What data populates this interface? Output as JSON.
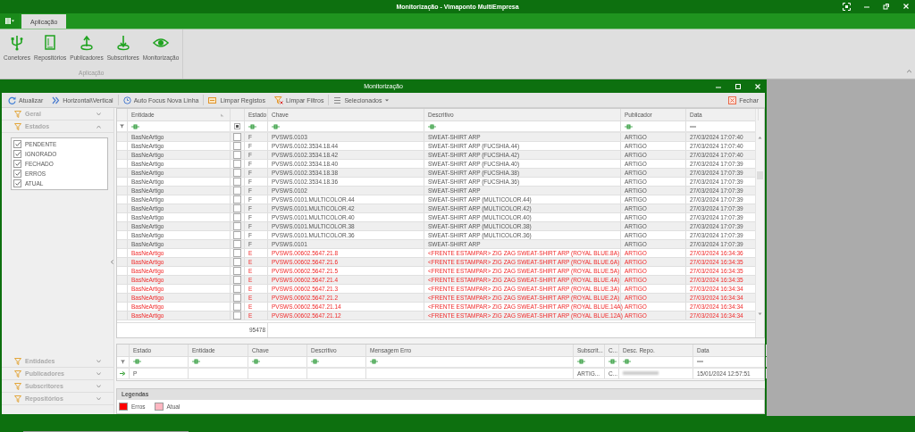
{
  "window": {
    "title": "Monitorização - Vimaponto MultiEmpresa"
  },
  "ribbon": {
    "tabs": [
      {
        "label": "Aplicação",
        "selected": true
      }
    ],
    "groups": [
      {
        "label": "Aplicação",
        "buttons": [
          {
            "label": "Conetores",
            "kind": "usb"
          },
          {
            "label": "Repositórios",
            "kind": "book"
          },
          {
            "label": "Publicadores",
            "kind": "upload"
          },
          {
            "label": "Subscritores",
            "kind": "download"
          },
          {
            "label": "Monitorização",
            "kind": "eye"
          }
        ]
      }
    ]
  },
  "child_window": {
    "title": "Monitorização"
  },
  "toolbar": {
    "buttons": [
      {
        "label": "Atualizar",
        "kind": "refresh"
      },
      {
        "label": "Horizontal\\Vertical",
        "kind": "chevrons"
      },
      {
        "label": "Auto Focus Nova Linha",
        "kind": "focus"
      },
      {
        "label": "Limpar Registos",
        "kind": "eraser"
      },
      {
        "label": "Limpar Filtros",
        "kind": "filterclear"
      },
      {
        "label": "Selecionados",
        "kind": "dropdown"
      }
    ],
    "close": {
      "label": "Fechar"
    }
  },
  "side_panel": {
    "top_sections": [
      {
        "label": "Geral",
        "expanded": false
      },
      {
        "label": "Estados",
        "expanded": true,
        "items": [
          {
            "label": "PENDENTE",
            "checked": true
          },
          {
            "label": "IGNORADO",
            "checked": true
          },
          {
            "label": "FECHADO",
            "checked": true
          },
          {
            "label": "ERROS",
            "checked": true
          },
          {
            "label": "ATUAL",
            "checked": true
          }
        ]
      }
    ],
    "bottom_sections": [
      {
        "label": "Entidades",
        "expanded": false
      },
      {
        "label": "Publicadores",
        "expanded": false
      },
      {
        "label": "Subscritores",
        "expanded": false
      },
      {
        "label": "Repositórios",
        "expanded": false
      }
    ]
  },
  "grid": {
    "columns": [
      {
        "label": "Entidade"
      },
      {
        "label": "Estado"
      },
      {
        "label": "Chave"
      },
      {
        "label": "Descritivo"
      },
      {
        "label": "Publicador"
      },
      {
        "label": "Data"
      }
    ],
    "rows": [
      {
        "entidade": "BasNeArtigo",
        "checked": false,
        "estado": "F",
        "chave": "PVSWS.0103",
        "descritivo": "SWEAT-SHIRT ARP",
        "publicador": "ARTIGO",
        "data": "27/03/2024 17:07:40",
        "error": false
      },
      {
        "entidade": "BasNeArtigo",
        "checked": false,
        "estado": "F",
        "chave": "PVSWS.0102.3534.18.44",
        "descritivo": "SWEAT-SHIRT ARP (FUCSHIA.44)",
        "publicador": "ARTIGO",
        "data": "27/03/2024 17:07:40",
        "error": false
      },
      {
        "entidade": "BasNeArtigo",
        "checked": false,
        "estado": "F",
        "chave": "PVSWS.0102.3534.18.42",
        "descritivo": "SWEAT-SHIRT ARP (FUCSHIA.42)",
        "publicador": "ARTIGO",
        "data": "27/03/2024 17:07:40",
        "error": false
      },
      {
        "entidade": "BasNeArtigo",
        "checked": false,
        "estado": "F",
        "chave": "PVSWS.0102.3534.18.40",
        "descritivo": "SWEAT-SHIRT ARP (FUCSHIA.40)",
        "publicador": "ARTIGO",
        "data": "27/03/2024 17:07:39",
        "error": false
      },
      {
        "entidade": "BasNeArtigo",
        "checked": false,
        "estado": "F",
        "chave": "PVSWS.0102.3534.18.38",
        "descritivo": "SWEAT-SHIRT ARP (FUCSHIA.38)",
        "publicador": "ARTIGO",
        "data": "27/03/2024 17:07:39",
        "error": false
      },
      {
        "entidade": "BasNeArtigo",
        "checked": false,
        "estado": "F",
        "chave": "PVSWS.0102.3534.18.36",
        "descritivo": "SWEAT-SHIRT ARP (FUCSHIA.36)",
        "publicador": "ARTIGO",
        "data": "27/03/2024 17:07:39",
        "error": false
      },
      {
        "entidade": "BasNeArtigo",
        "checked": false,
        "estado": "F",
        "chave": "PVSWS.0102",
        "descritivo": "SWEAT-SHIRT ARP",
        "publicador": "ARTIGO",
        "data": "27/03/2024 17:07:39",
        "error": false
      },
      {
        "entidade": "BasNeArtigo",
        "checked": false,
        "estado": "F",
        "chave": "PVSWS.0101.MULTICOLOR.44",
        "descritivo": "SWEAT-SHIRT ARP (MULTICOLOR.44)",
        "publicador": "ARTIGO",
        "data": "27/03/2024 17:07:39",
        "error": false
      },
      {
        "entidade": "BasNeArtigo",
        "checked": false,
        "estado": "F",
        "chave": "PVSWS.0101.MULTICOLOR.42",
        "descritivo": "SWEAT-SHIRT ARP (MULTICOLOR.42)",
        "publicador": "ARTIGO",
        "data": "27/03/2024 17:07:39",
        "error": false
      },
      {
        "entidade": "BasNeArtigo",
        "checked": false,
        "estado": "F",
        "chave": "PVSWS.0101.MULTICOLOR.40",
        "descritivo": "SWEAT-SHIRT ARP (MULTICOLOR.40)",
        "publicador": "ARTIGO",
        "data": "27/03/2024 17:07:39",
        "error": false
      },
      {
        "entidade": "BasNeArtigo",
        "checked": false,
        "estado": "F",
        "chave": "PVSWS.0101.MULTICOLOR.38",
        "descritivo": "SWEAT-SHIRT ARP (MULTICOLOR.38)",
        "publicador": "ARTIGO",
        "data": "27/03/2024 17:07:39",
        "error": false
      },
      {
        "entidade": "BasNeArtigo",
        "checked": false,
        "estado": "F",
        "chave": "PVSWS.0101.MULTICOLOR.36",
        "descritivo": "SWEAT-SHIRT ARP (MULTICOLOR.36)",
        "publicador": "ARTIGO",
        "data": "27/03/2024 17:07:39",
        "error": false
      },
      {
        "entidade": "BasNeArtigo",
        "checked": false,
        "estado": "F",
        "chave": "PVSWS.0101",
        "descritivo": "SWEAT-SHIRT ARP",
        "publicador": "ARTIGO",
        "data": "27/03/2024 17:07:39",
        "error": false
      },
      {
        "entidade": "BasNeArtigo",
        "checked": false,
        "estado": "E",
        "chave": "PVSWS.00602.5647.21.8",
        "descritivo": "<FRENTE ESTAMPAR> ZIG ZAG SWEAT-SHIRT ARP (ROYAL BLUE.8A)",
        "publicador": "ARTIGO",
        "data": "27/03/2024 16:34:36",
        "error": true
      },
      {
        "entidade": "BasNeArtigo",
        "checked": false,
        "estado": "E",
        "chave": "PVSWS.00602.5647.21.6",
        "descritivo": "<FRENTE ESTAMPAR> ZIG ZAG SWEAT-SHIRT ARP (ROYAL BLUE.6A)",
        "publicador": "ARTIGO",
        "data": "27/03/2024 16:34:35",
        "error": true
      },
      {
        "entidade": "BasNeArtigo",
        "checked": false,
        "estado": "E",
        "chave": "PVSWS.00602.5647.21.5",
        "descritivo": "<FRENTE ESTAMPAR> ZIG ZAG SWEAT-SHIRT ARP (ROYAL BLUE.5A)",
        "publicador": "ARTIGO",
        "data": "27/03/2024 16:34:35",
        "error": true
      },
      {
        "entidade": "BasNeArtigo",
        "checked": false,
        "estado": "E",
        "chave": "PVSWS.00602.5647.21.4",
        "descritivo": "<FRENTE ESTAMPAR> ZIG ZAG SWEAT-SHIRT ARP (ROYAL BLUE.4A)",
        "publicador": "ARTIGO",
        "data": "27/03/2024 16:34:35",
        "error": true
      },
      {
        "entidade": "BasNeArtigo",
        "checked": false,
        "estado": "E",
        "chave": "PVSWS.00602.5647.21.3",
        "descritivo": "<FRENTE ESTAMPAR> ZIG ZAG SWEAT-SHIRT ARP (ROYAL BLUE.3A)",
        "publicador": "ARTIGO",
        "data": "27/03/2024 16:34:34",
        "error": true
      },
      {
        "entidade": "BasNeArtigo",
        "checked": false,
        "estado": "E",
        "chave": "PVSWS.00602.5647.21.2",
        "descritivo": "<FRENTE ESTAMPAR> ZIG ZAG SWEAT-SHIRT ARP (ROYAL BLUE.2A)",
        "publicador": "ARTIGO",
        "data": "27/03/2024 16:34:34",
        "error": true
      },
      {
        "entidade": "BasNeArtigo",
        "checked": false,
        "estado": "E",
        "chave": "PVSWS.00602.5647.21.14",
        "descritivo": "<FRENTE ESTAMPAR> ZIG ZAG SWEAT-SHIRT ARP (ROYAL BLUE.14A)",
        "publicador": "ARTIGO",
        "data": "27/03/2024 16:34:34",
        "error": true
      },
      {
        "entidade": "BasNeArtigo",
        "checked": false,
        "estado": "E",
        "chave": "PVSWS.00602.5647.21.12",
        "descritivo": "<FRENTE ESTAMPAR> ZIG ZAG SWEAT-SHIRT ARP (ROYAL BLUE.12A)",
        "publicador": "ARTIGO",
        "data": "27/03/2024 16:34:34",
        "error": true
      }
    ],
    "footer": {
      "count": "95478"
    }
  },
  "detail_grid": {
    "columns": [
      {
        "label": "Estado"
      },
      {
        "label": "Entidade"
      },
      {
        "label": "Chave"
      },
      {
        "label": "Descritivo"
      },
      {
        "label": "Mensagem Erro"
      },
      {
        "label": "Subscrit..."
      },
      {
        "label": "C..."
      },
      {
        "label": "Desc. Repo."
      },
      {
        "label": "Data"
      }
    ],
    "rows": [
      {
        "current": true,
        "estado": "P",
        "subscritor": "ARTIG...",
        "column_7": "C...",
        "desc_repo_redacted": true,
        "data": "15/01/2024 12:57:51"
      }
    ]
  },
  "legend": {
    "title": "Legendas",
    "items": [
      {
        "label": "Erros",
        "color": "#ff0000"
      },
      {
        "label": "Atual",
        "color": "#ffb6c1"
      }
    ]
  }
}
